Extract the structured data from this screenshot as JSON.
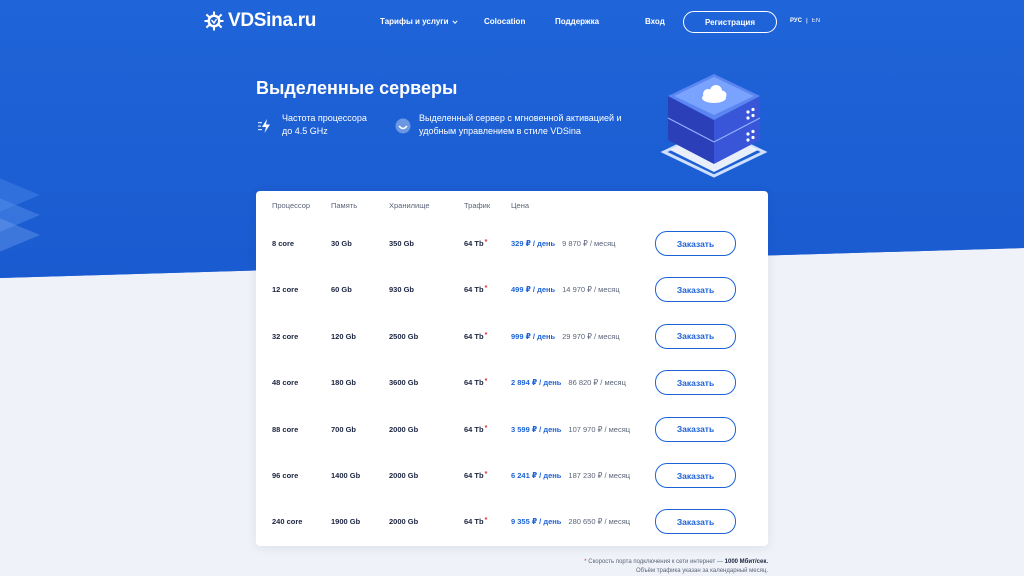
{
  "header": {
    "logo_text": "VDSina.ru",
    "nav": [
      {
        "label": "Тарифы и услуги",
        "has_dropdown": true
      },
      {
        "label": "Colocation"
      },
      {
        "label": "Поддержка"
      },
      {
        "label": "Вход"
      }
    ],
    "register_label": "Регистрация",
    "lang": {
      "ru": "РУС",
      "separator": "|",
      "en": "EN"
    }
  },
  "hero": {
    "title": "Выделенные серверы",
    "features": [
      {
        "icon": "lightning-icon",
        "line1": "Частота процессора",
        "line2": "до 4.5 GHz"
      },
      {
        "icon": "smile-icon",
        "line1": "Выделенный сервер с мгновенной активацией и",
        "line2": "удобным управлением в стиле VDSina"
      }
    ]
  },
  "table": {
    "headers": {
      "cpu": "Процессор",
      "ram": "Память",
      "storage": "Хранилище",
      "traffic": "Трафик",
      "price": "Цена"
    },
    "order_label": "Заказать",
    "rows": [
      {
        "cpu": "8 core",
        "ram": "30 Gb",
        "storage": "350 Gb",
        "traffic": "64 Tb",
        "star": "*",
        "price_day": "329 ₽ / день",
        "price_month": "9 870 ₽ / месяц"
      },
      {
        "cpu": "12 core",
        "ram": "60 Gb",
        "storage": "930 Gb",
        "traffic": "64 Tb",
        "star": "*",
        "price_day": "499 ₽ / день",
        "price_month": "14 970 ₽ / месяц"
      },
      {
        "cpu": "32 core",
        "ram": "120 Gb",
        "storage": "2500 Gb",
        "traffic": "64 Tb",
        "star": "*",
        "price_day": "999 ₽ / день",
        "price_month": "29 970 ₽ / месяц"
      },
      {
        "cpu": "48 core",
        "ram": "180 Gb",
        "storage": "3600 Gb",
        "traffic": "64 Tb",
        "star": "*",
        "price_day": "2 894 ₽ / день",
        "price_month": "86 820 ₽ / месяц"
      },
      {
        "cpu": "88 core",
        "ram": "700 Gb",
        "storage": "2000 Gb",
        "traffic": "64 Tb",
        "star": "*",
        "price_day": "3 599 ₽ / день",
        "price_month": "107 970 ₽ / месяц"
      },
      {
        "cpu": "96 core",
        "ram": "1400 Gb",
        "storage": "2000 Gb",
        "traffic": "64 Tb",
        "star": "*",
        "price_day": "6 241 ₽ / день",
        "price_month": "187 230 ₽ / месяц"
      },
      {
        "cpu": "240 core",
        "ram": "1900 Gb",
        "storage": "2000 Gb",
        "traffic": "64 Tb",
        "star": "*",
        "price_day": "9 355 ₽ / день",
        "price_month": "280 650 ₽ / месяц"
      }
    ]
  },
  "footnote": {
    "star": "*",
    "line1_prefix": "Скорость порта подключения к сети интернет — ",
    "line1_bold": "1000 Мбит/сек.",
    "line2": "Объём трафика указан за календарный месяц."
  },
  "colors": {
    "brand_blue": "#1d5fd1",
    "accent_blue": "#1d63d6",
    "star_red": "#e0303a"
  }
}
